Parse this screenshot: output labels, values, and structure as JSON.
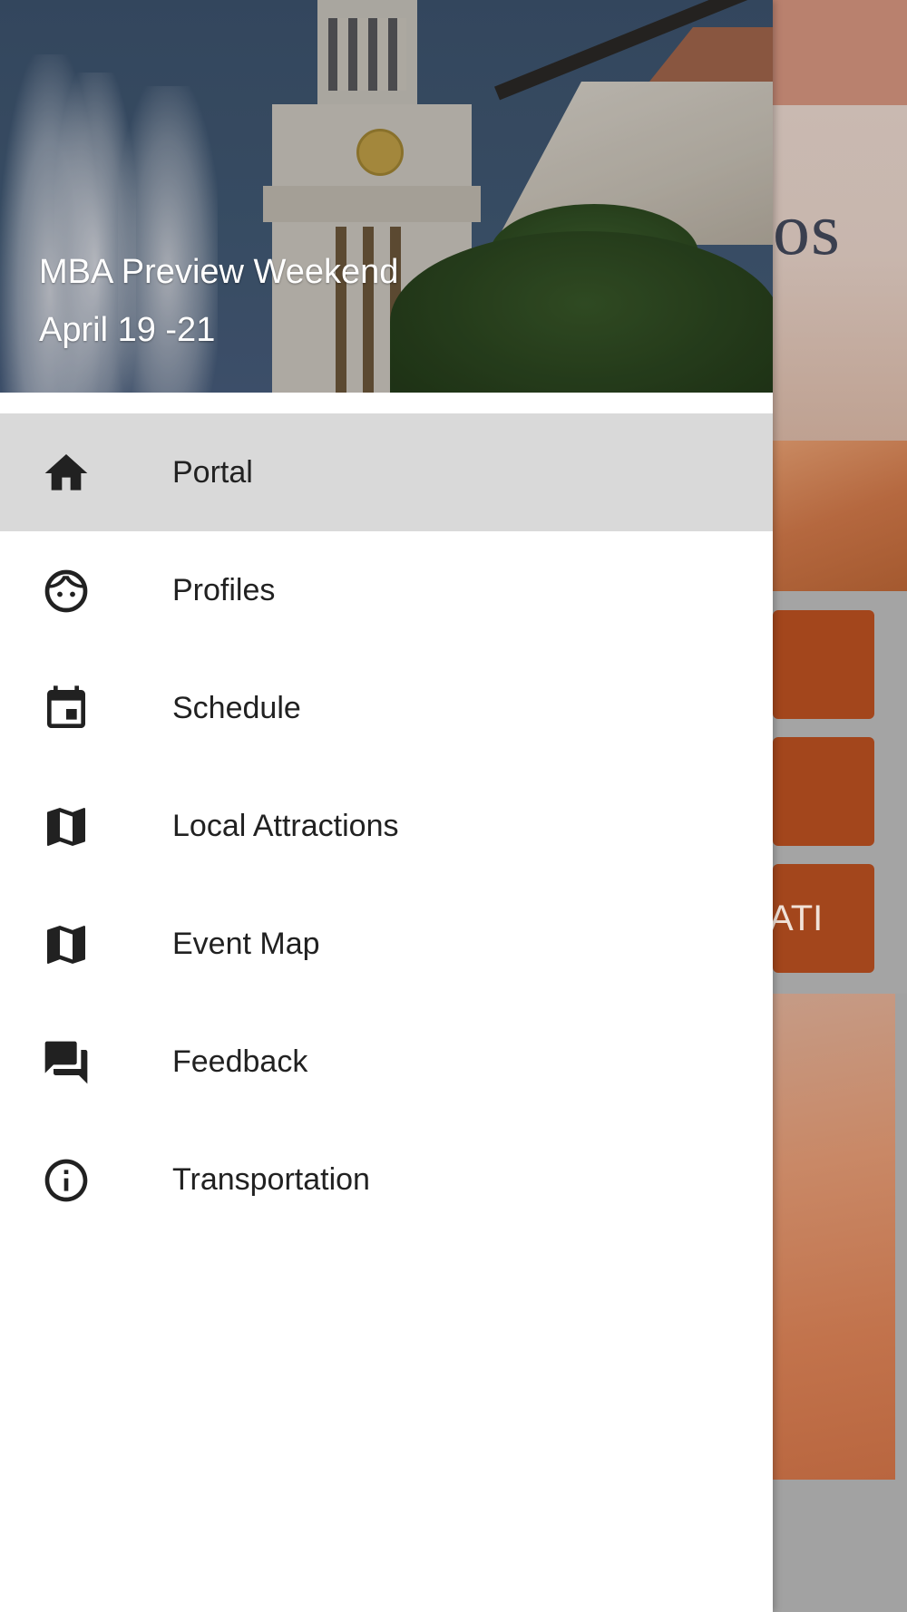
{
  "drawer": {
    "header": {
      "title": "MBA Preview Weekend",
      "subtitle": "April 19 -21"
    },
    "items": [
      {
        "label": "Portal",
        "icon": "home-icon",
        "selected": true
      },
      {
        "label": "Profiles",
        "icon": "face-icon",
        "selected": false
      },
      {
        "label": "Schedule",
        "icon": "calendar-icon",
        "selected": false
      },
      {
        "label": "Local Attractions",
        "icon": "map-icon",
        "selected": false
      },
      {
        "label": "Event Map",
        "icon": "map-icon",
        "selected": false
      },
      {
        "label": "Feedback",
        "icon": "forum-icon",
        "selected": false
      },
      {
        "label": "Transportation",
        "icon": "info-icon",
        "selected": false
      }
    ]
  },
  "background": {
    "logo_fragment": "os",
    "button_fragment": "ATI"
  },
  "colors": {
    "selected_item_bg": "#d9d9d9",
    "drawer_bg": "#ffffff",
    "icon_color": "#212121",
    "accent_burnt_orange": "#a3461c",
    "scrim": "#a2a2a2"
  }
}
